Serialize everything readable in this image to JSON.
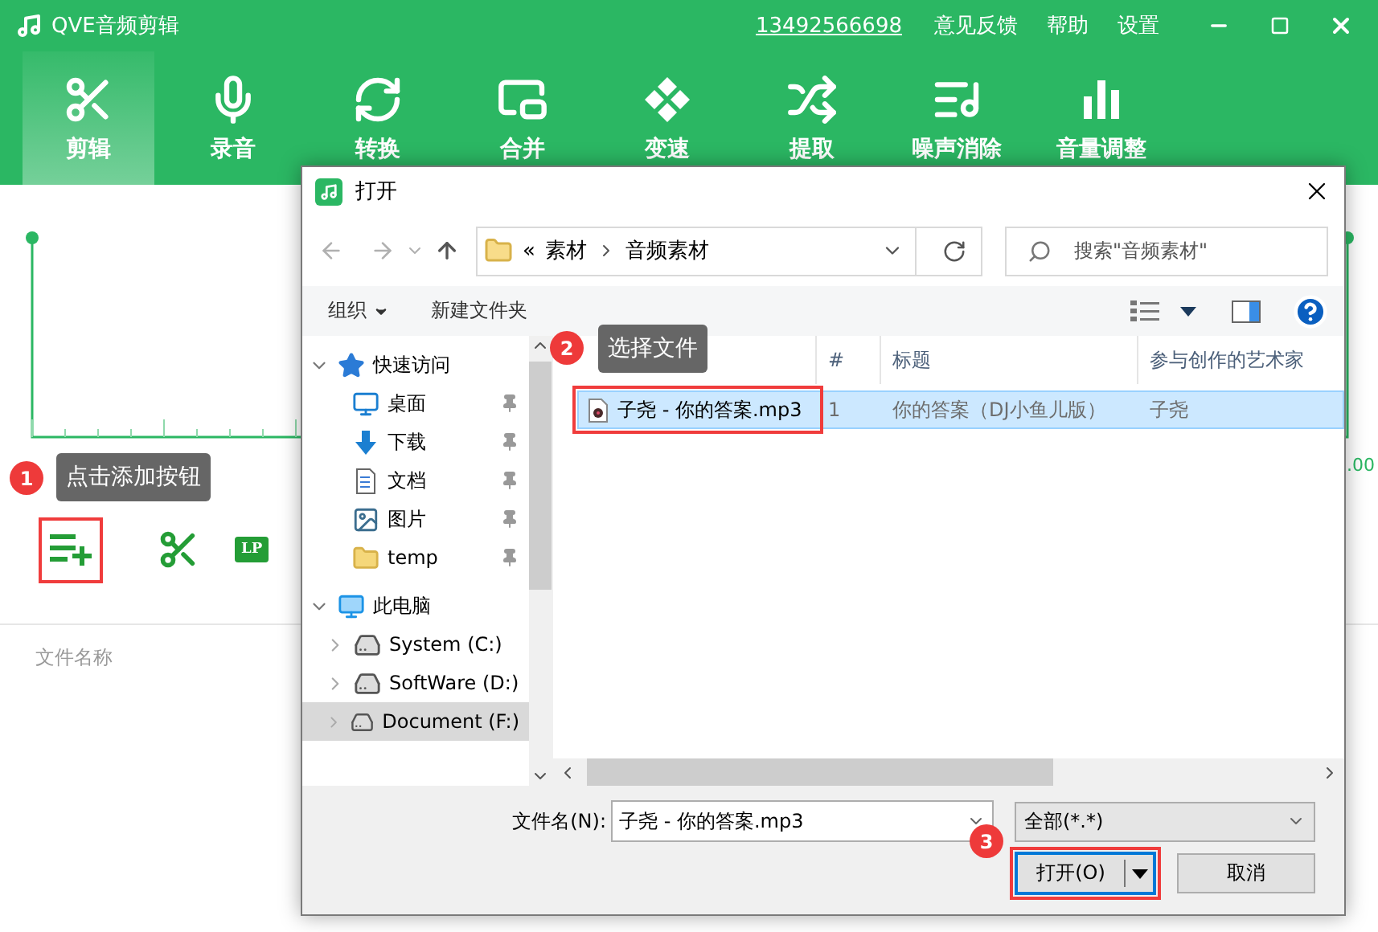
{
  "app": {
    "title": "QVE音频剪辑",
    "phone": "13492566698",
    "menu": [
      "意见反馈",
      "帮助",
      "设置"
    ]
  },
  "tools": [
    {
      "label": "剪辑",
      "kind": "scissors",
      "selected": true
    },
    {
      "label": "录音",
      "kind": "mic",
      "selected": false
    },
    {
      "label": "转换",
      "kind": "convert",
      "selected": false
    },
    {
      "label": "合并",
      "kind": "merge",
      "selected": false
    },
    {
      "label": "变速",
      "kind": "speed",
      "selected": false
    },
    {
      "label": "提取",
      "kind": "extract",
      "selected": false
    },
    {
      "label": "噪声消除",
      "kind": "denoise",
      "selected": false
    },
    {
      "label": "音量调整",
      "kind": "volume",
      "selected": false
    }
  ],
  "editor": {
    "end_time": ".00",
    "lp": "LP",
    "file_header": "文件名称"
  },
  "callouts": [
    {
      "number": "1",
      "text": "点击添加按钮"
    },
    {
      "number": "2",
      "text": "选择文件"
    },
    {
      "number": "3"
    }
  ],
  "dialog": {
    "title": "打开",
    "path_prefix": "«",
    "path": [
      "素材",
      "音频素材"
    ],
    "search_placeholder": "搜索\"音频素材\"",
    "commands": [
      {
        "label": "组织",
        "menu": true
      },
      {
        "label": "新建文件夹",
        "menu": false
      }
    ],
    "nav": [
      {
        "label": "快速访问",
        "kind": "star",
        "expanded": true,
        "selected": false,
        "children": [
          {
            "label": "桌面",
            "kind": "desktop",
            "pinned": true,
            "selected": false
          },
          {
            "label": "下载",
            "kind": "download",
            "pinned": true,
            "selected": false
          },
          {
            "label": "文档",
            "kind": "document",
            "pinned": true,
            "selected": false
          },
          {
            "label": "图片",
            "kind": "picture",
            "pinned": true,
            "selected": false
          },
          {
            "label": "temp",
            "kind": "folder",
            "pinned": true,
            "selected": false
          }
        ]
      },
      {
        "label": "此电脑",
        "kind": "pc",
        "expanded": true,
        "selected": false,
        "children": [
          {
            "label": "System (C:)",
            "kind": "drive-system",
            "expanded": false,
            "selected": false
          },
          {
            "label": "SoftWare (D:)",
            "kind": "drive",
            "expanded": false,
            "selected": false
          },
          {
            "label": "Document (F:)",
            "kind": "drive",
            "expanded": false,
            "selected": true
          }
        ]
      }
    ],
    "columns": [
      "#",
      "标题",
      "参与创作的艺术家"
    ],
    "files": [
      {
        "name": "子尧 - 你的答案.mp3",
        "number": "1",
        "title": "你的答案（DJ小鱼儿版）",
        "artist": "子尧",
        "selected": true
      }
    ],
    "filename_label": "文件名(N):",
    "filename": "子尧 - 你的答案.mp3",
    "filetype": "全部(*.*)",
    "open": "打开(O)",
    "cancel": "取消"
  }
}
